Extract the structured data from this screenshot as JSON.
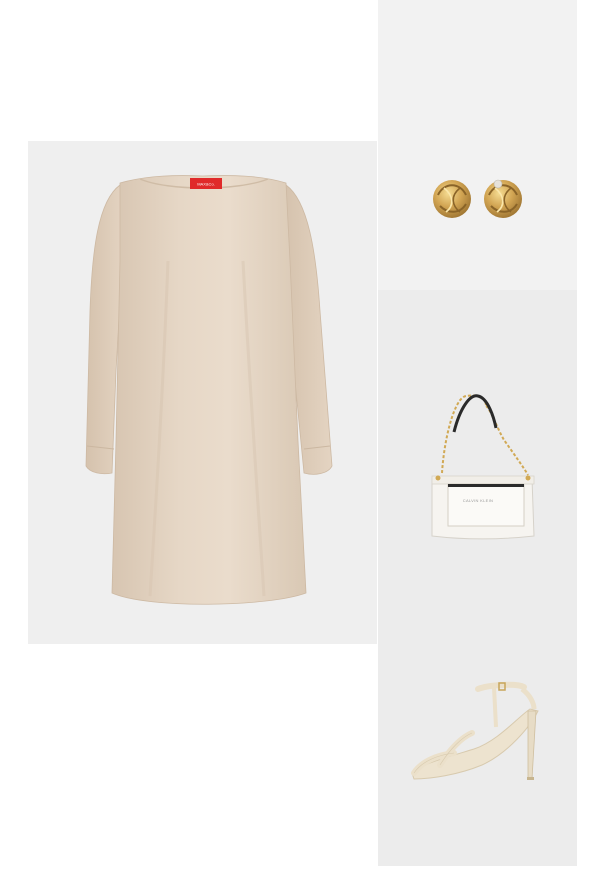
{
  "outfit": {
    "products": [
      {
        "name": "Dress",
        "color": "#e3d3c1"
      },
      {
        "name": "Earrings",
        "color": "#c99b46"
      },
      {
        "name": "Handbag",
        "color": "#f6f4f0"
      },
      {
        "name": "Sandals",
        "color": "#ede3cf"
      }
    ],
    "brand_tag": "MAX&Co.",
    "bag_logo": "CALVIN KLEIN"
  },
  "colors": {
    "background": "#ffffff",
    "tile_grey": "#efefef",
    "tag_red": "#e02a2a",
    "gold": "#c99b46"
  }
}
